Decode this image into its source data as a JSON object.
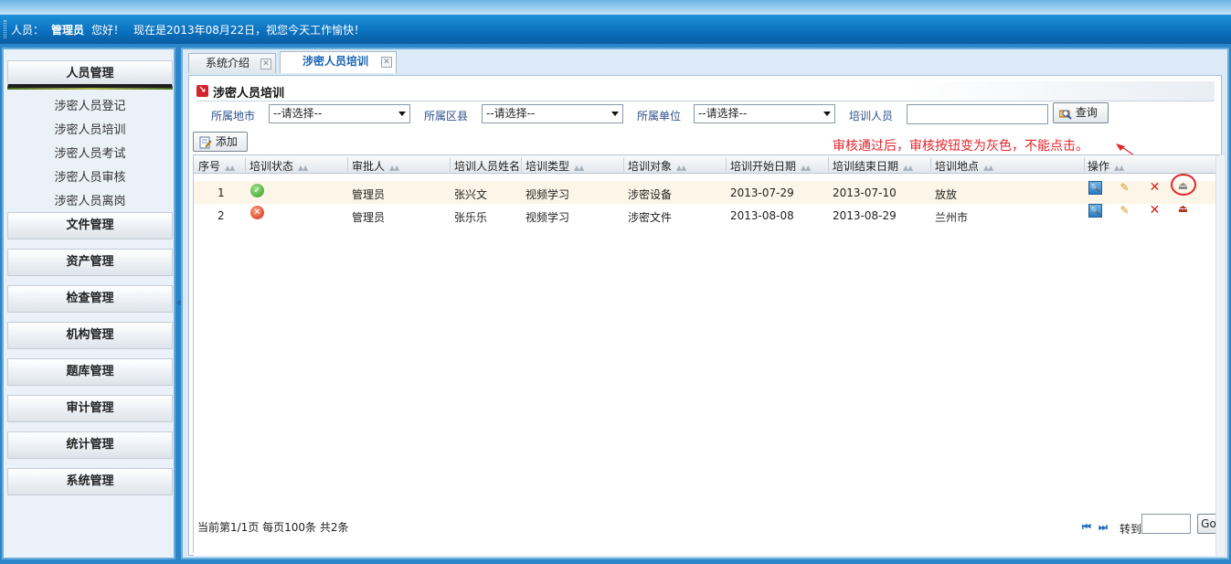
{
  "header": {
    "user_label": "人员：",
    "user_name": "管理员",
    "greeting": "您好！",
    "date_msg": "现在是2013年08月22日，视您今天工作愉快！"
  },
  "sidebar": {
    "sections": [
      {
        "label": "人员管理",
        "active": true
      },
      {
        "label": "文件管理"
      },
      {
        "label": "资产管理"
      },
      {
        "label": "检查管理"
      },
      {
        "label": "机构管理"
      },
      {
        "label": "题库管理"
      },
      {
        "label": "审计管理"
      },
      {
        "label": "统计管理"
      },
      {
        "label": "系统管理"
      }
    ],
    "sub_items": [
      "涉密人员登记",
      "涉密人员培训",
      "涉密人员考试",
      "涉密人员审核",
      "涉密人员离岗"
    ],
    "collapse": "«"
  },
  "tabs": [
    {
      "label": "系统介绍"
    },
    {
      "label": "涉密人员培训",
      "active": true
    }
  ],
  "section_title": "涉密人员培训",
  "filters": {
    "city_label": "所属地市",
    "city_value": "--请选择--",
    "district_label": "所属区县",
    "district_value": "--请选择--",
    "unit_label": "所属单位",
    "unit_value": "--请选择--",
    "trainee_label": "培训人员",
    "trainee_value": "",
    "query_button": "查询"
  },
  "add_button": "添加",
  "annotation": "审核通过后，审核按钮变为灰色，不能点击。",
  "table": {
    "columns": [
      "序号",
      "培训状态",
      "审批人",
      "培训人员姓名",
      "培训类型",
      "培训对象",
      "培训开始日期",
      "培训结束日期",
      "培训地点",
      "操作"
    ],
    "rows": [
      {
        "no": "1",
        "status": "approved",
        "approver": "管理员",
        "name": "张兴文",
        "type": "视频学习",
        "target": "涉密设备",
        "start": "2013-07-29",
        "end": "2013-07-10",
        "location": "放放"
      },
      {
        "no": "2",
        "status": "rejected",
        "approver": "管理员",
        "name": "张乐乐",
        "type": "视频学习",
        "target": "涉密文件",
        "start": "2013-08-08",
        "end": "2013-08-29",
        "location": "兰州市"
      }
    ]
  },
  "pager": {
    "info": "当前第1/1页 每页100条 共2条",
    "first": "⏮",
    "last": "⏭",
    "goto_label": "转到",
    "go_button": "Go"
  },
  "colors": {
    "header_blue": "#0a6fbd",
    "annotation_red": "#e3242b",
    "approved_green": "#2e9a22",
    "rejected_red": "#d22c12"
  }
}
